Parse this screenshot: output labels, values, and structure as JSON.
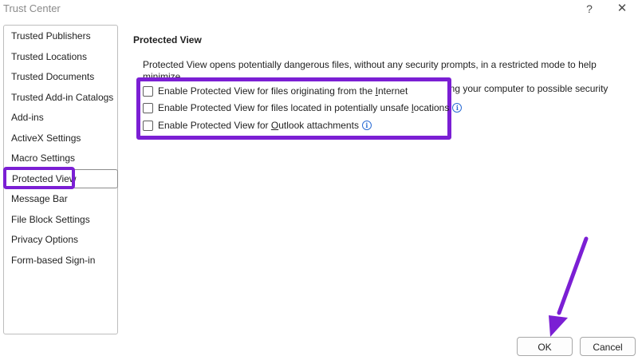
{
  "window": {
    "title": "Trust Center",
    "help_label": "?",
    "close_label": "✕"
  },
  "sidebar": {
    "items": [
      {
        "label": "Trusted Publishers"
      },
      {
        "label": "Trusted Locations"
      },
      {
        "label": "Trusted Documents"
      },
      {
        "label": "Trusted Add-in Catalogs"
      },
      {
        "label": "Add-ins"
      },
      {
        "label": "ActiveX Settings"
      },
      {
        "label": "Macro Settings"
      },
      {
        "label": "Protected View",
        "selected": true
      },
      {
        "label": "Message Bar"
      },
      {
        "label": "File Block Settings"
      },
      {
        "label": "Privacy Options"
      },
      {
        "label": "Form-based Sign-in"
      }
    ]
  },
  "main": {
    "section_title": "Protected View",
    "description_line1": "Protected View opens potentially dangerous files, without any security prompts, in a restricted mode to help minimize",
    "description_line2": "harm to your computer. By disabling Protected View you could be exposing your computer to possible security threats.",
    "options": [
      {
        "pre": "Enable Protected View for files originating from the ",
        "key": "I",
        "post": "nternet",
        "checked": false,
        "info": false
      },
      {
        "pre": "Enable Protected View for files located in potentially unsafe ",
        "key": "l",
        "post": "ocations",
        "checked": false,
        "info": true
      },
      {
        "pre": "Enable Protected View for ",
        "key": "O",
        "post": "utlook attachments",
        "checked": false,
        "info": true
      }
    ],
    "info_glyph": "i"
  },
  "footer": {
    "ok_label": "OK",
    "cancel_label": "Cancel"
  },
  "colors": {
    "highlight": "#7b1fd4",
    "info": "#2b6cd4"
  }
}
